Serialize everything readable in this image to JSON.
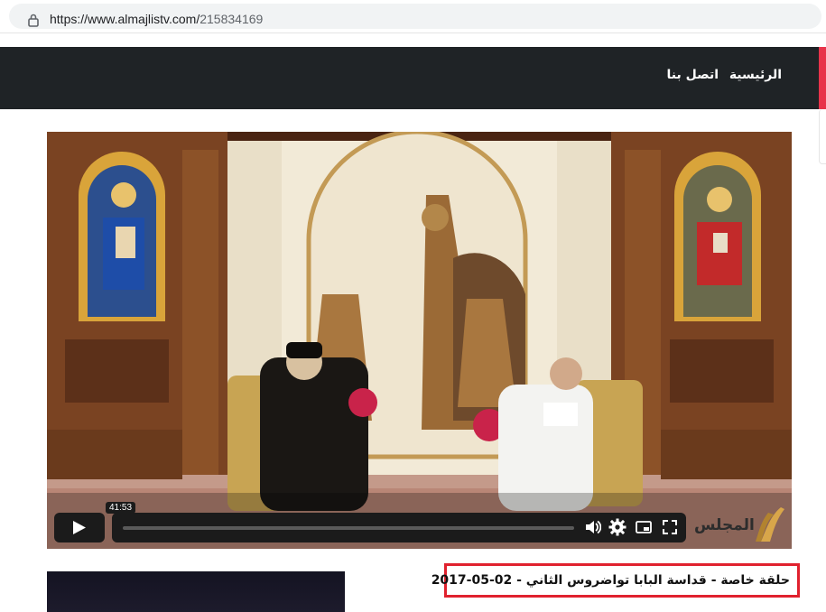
{
  "browser": {
    "url_domain": "https://www.almajlistv.com/",
    "url_path": "215834169"
  },
  "nav": {
    "items": [
      {
        "label": "الرئيسية"
      },
      {
        "label": "اتصل بنا"
      }
    ]
  },
  "video": {
    "time": "41:53",
    "progress": 0.0,
    "logo_text": "المجلس"
  },
  "article": {
    "title": "حلقة خاصة - قداسة البابا تواضروس الثاني - 02-05-2017"
  },
  "colors": {
    "nav_bg": "#1f2326",
    "accent": "#e8334a",
    "highlight_border": "#e0212e"
  }
}
